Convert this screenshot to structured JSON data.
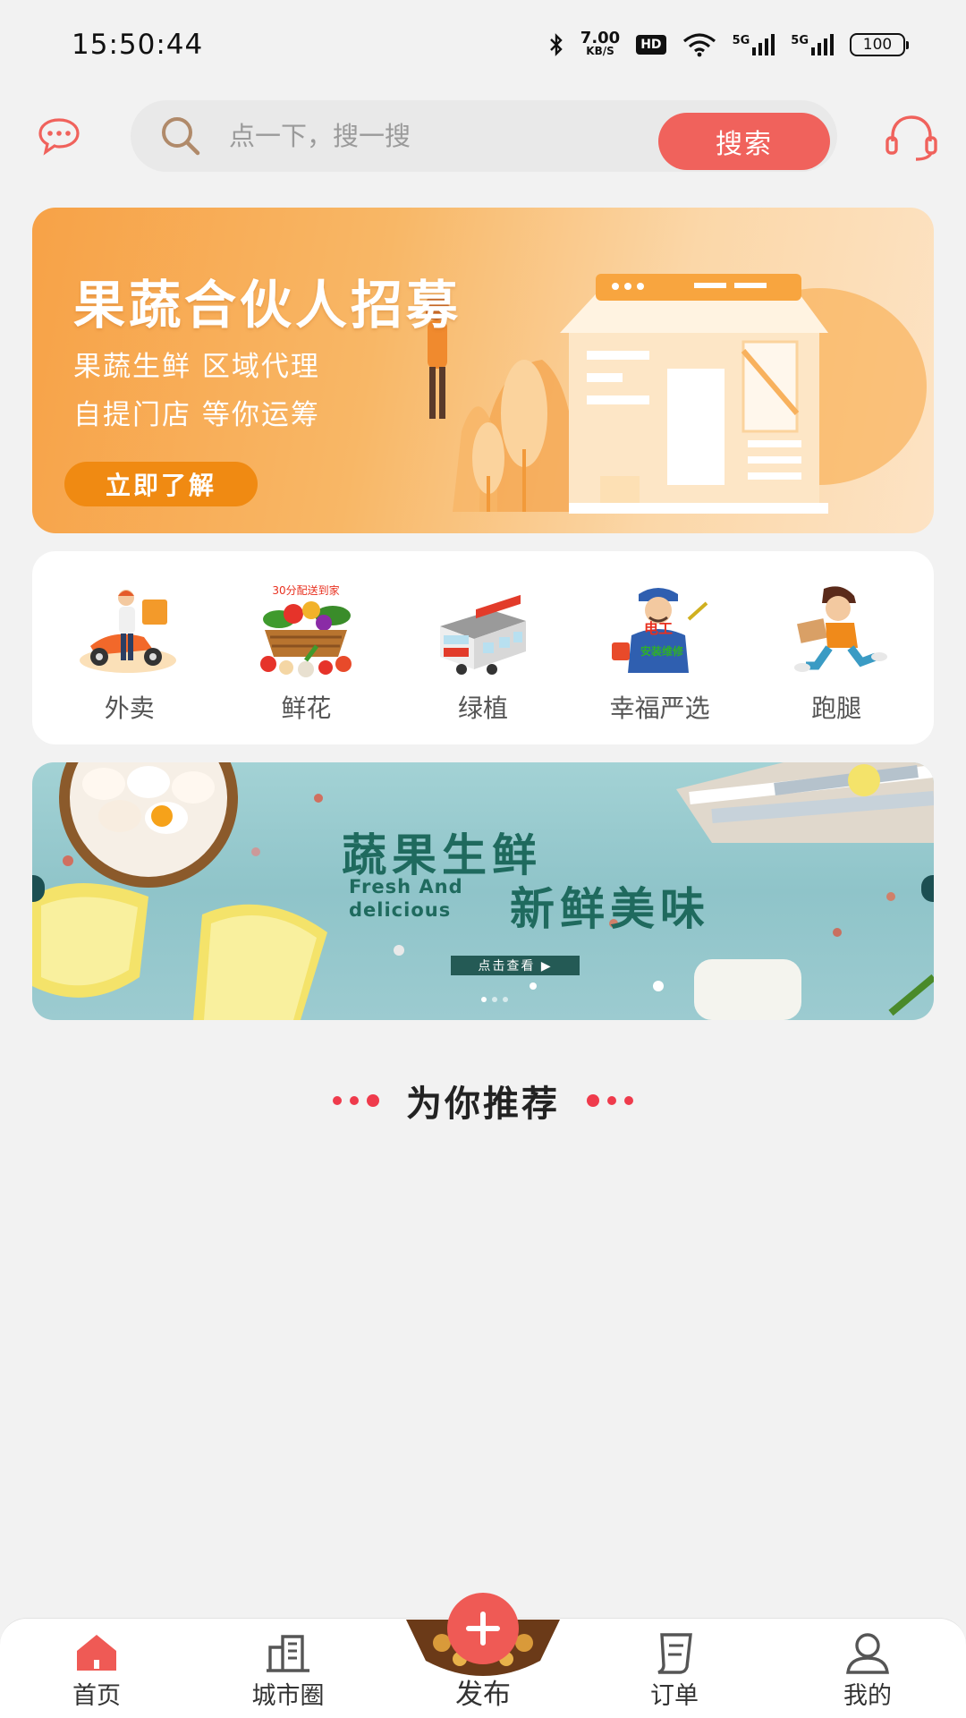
{
  "status_bar": {
    "time": "15:50:44",
    "speed_value": "7.00",
    "speed_unit": "KB/S",
    "hd_label": "HD",
    "sim1_net": "5G",
    "sim2_net": "5G",
    "battery": "100"
  },
  "search": {
    "placeholder": "点一下，搜一搜",
    "button_label": "搜索"
  },
  "promo_banner": {
    "title": "果蔬合伙人招募",
    "line1": "果蔬生鲜  区域代理",
    "line2": "自提门店  等你运筹",
    "button_label": "立即了解"
  },
  "categories": [
    {
      "label": "外卖",
      "icon": "delivery-rider-icon"
    },
    {
      "label": "鲜花",
      "icon": "vegetable-basket-icon",
      "badge": "30分配送到家"
    },
    {
      "label": "绿植",
      "icon": "store-building-icon"
    },
    {
      "label": "幸福严选",
      "icon": "electrician-icon"
    },
    {
      "label": "跑腿",
      "icon": "courier-runner-icon"
    }
  ],
  "fresh_banner": {
    "title": "蔬果生鲜",
    "subtitle": "新鲜美味",
    "english_line1": "Fresh And",
    "english_line2": "delicious",
    "button_label": "点击查看 ▶"
  },
  "recommend": {
    "title": "为你推荐"
  },
  "tabbar": {
    "home": "首页",
    "city": "城市圈",
    "publish": "发布",
    "orders": "订单",
    "mine": "我的"
  },
  "colors": {
    "accent": "#f0625c",
    "promo_orange": "#f7a247",
    "dot_red": "#ef3b4c"
  }
}
